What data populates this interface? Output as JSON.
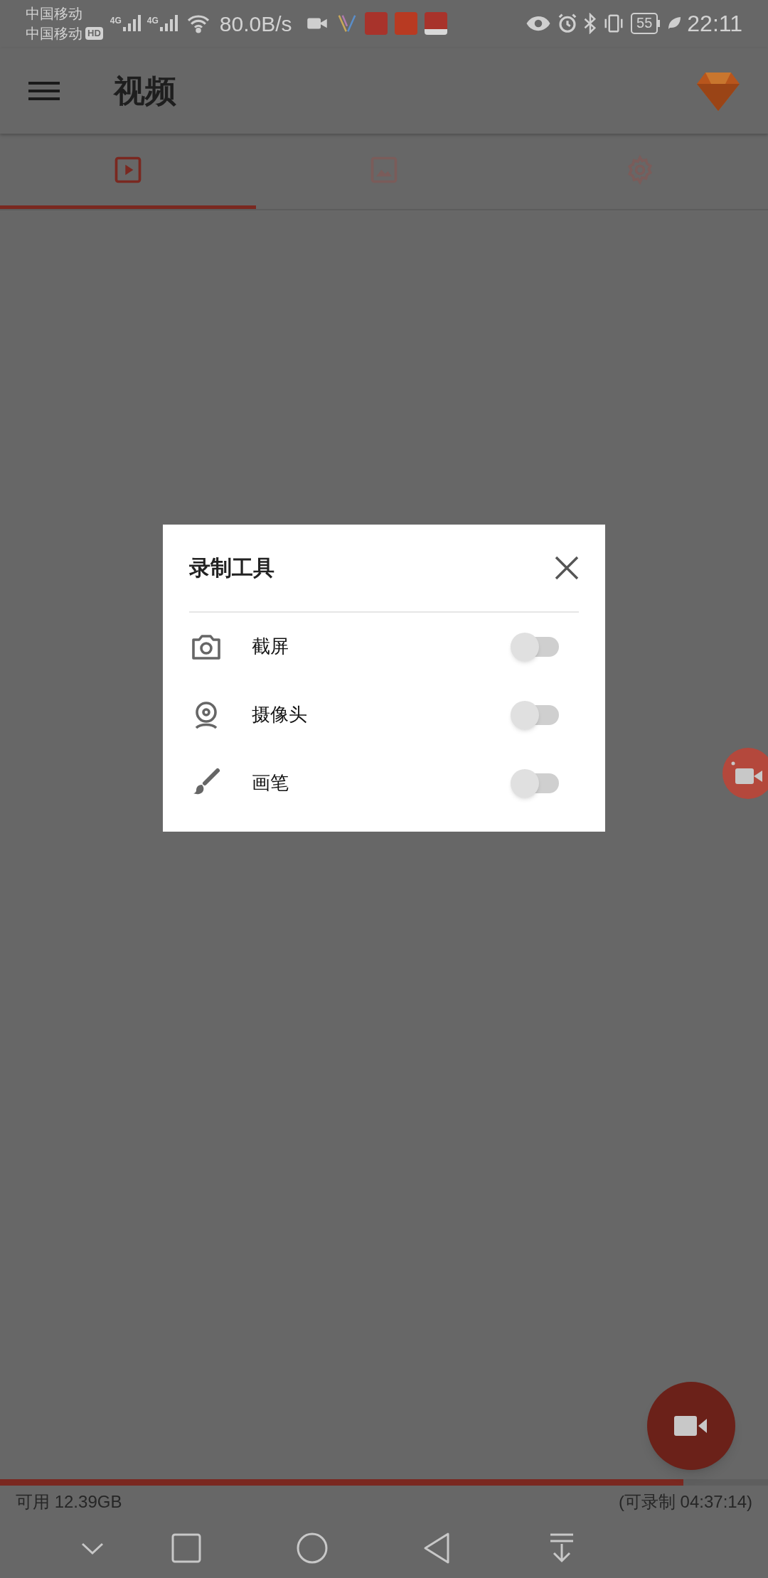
{
  "status_bar": {
    "carrier_1": "中国移动",
    "carrier_2": "中国移动",
    "hd_badge": "HD",
    "network_1": "4G",
    "network_2": "4G",
    "speed": "80.0B/s",
    "battery": "55",
    "time": "22:11"
  },
  "app_bar": {
    "title": "视频"
  },
  "tabs": [
    {
      "kind": "video",
      "selected": true
    },
    {
      "kind": "image",
      "selected": false
    },
    {
      "kind": "settings",
      "selected": false
    }
  ],
  "dialog": {
    "title": "录制工具",
    "items": [
      {
        "kind": "camera",
        "label": "截屏",
        "on": false
      },
      {
        "kind": "webcam",
        "label": "摄像头",
        "on": false
      },
      {
        "kind": "brush",
        "label": "画笔",
        "on": false
      }
    ]
  },
  "storage": {
    "available": "可用 12.39GB",
    "remaining": "(可录制 04:37:14)",
    "level": 0.89
  }
}
